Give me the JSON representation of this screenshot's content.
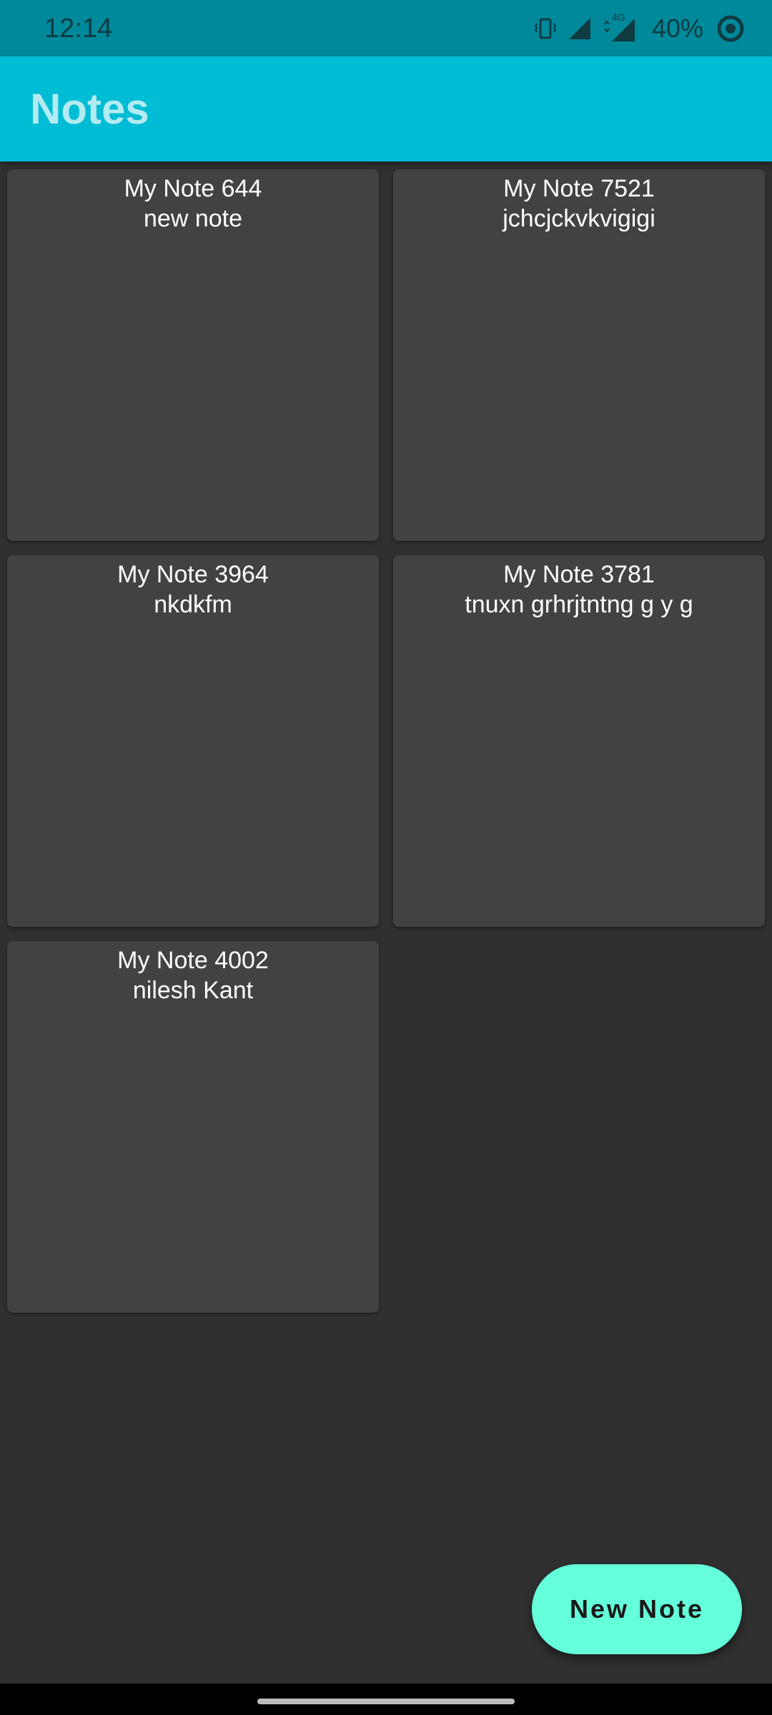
{
  "status_bar": {
    "time": "12:14",
    "network_label": "4G",
    "battery": "40%",
    "icons": [
      "vibrate-icon",
      "signal-icon",
      "signal-4g-icon",
      "battery-ring-icon"
    ]
  },
  "app_bar": {
    "title": "Notes"
  },
  "notes": [
    {
      "title": "My Note 644",
      "body": "new note"
    },
    {
      "title": "My Note 7521",
      "body": "jchcjckvkvigigi"
    },
    {
      "title": "My Note 3964",
      "body": "nkdkfm"
    },
    {
      "title": "My Note 3781",
      "body": "tnuxn grhrjtntng g y g"
    },
    {
      "title": "My Note 4002",
      "body": "nilesh Kant"
    }
  ],
  "fab": {
    "label": "New Note"
  },
  "colors": {
    "status_bar": "#00899b",
    "app_bar": "#00bcd4",
    "title_text": "#b2ebf2",
    "background": "#303030",
    "card": "#424242",
    "fab": "#64ffda"
  }
}
